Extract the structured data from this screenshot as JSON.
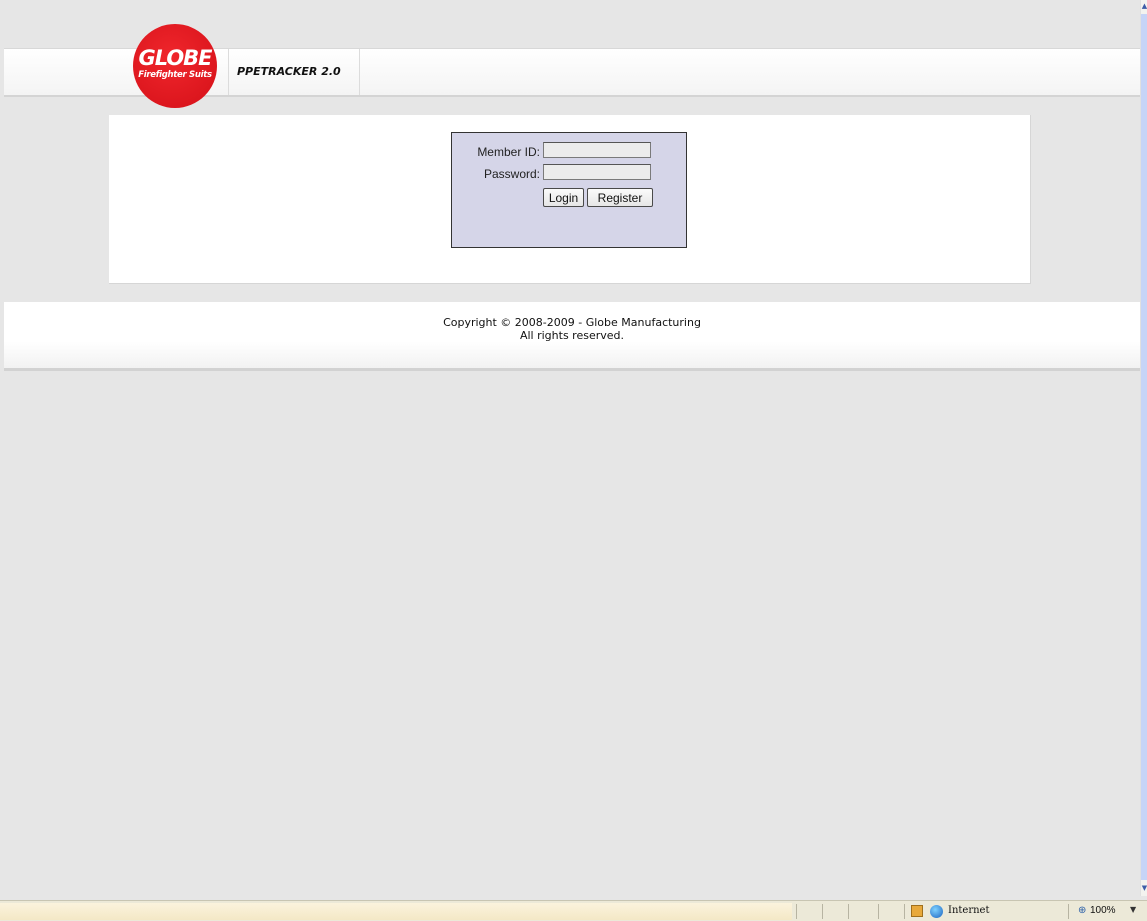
{
  "header": {
    "logo_text": "GLOBE",
    "logo_subtext": "Firefighter Suits",
    "app_title": "PPETRACKER 2.0"
  },
  "login": {
    "member_id_label": "Member ID:",
    "member_id_value": "",
    "password_label": "Password:",
    "password_value": "",
    "login_button": "Login",
    "register_button": "Register",
    "box_color": "#d5d5e8"
  },
  "footer": {
    "copyright": "Copyright © 2008-2009 - Globe Manufacturing",
    "rights": "All rights reserved."
  },
  "statusbar": {
    "zone_label": "Internet",
    "zoom_label": "100%",
    "icons": [
      "security-zone-icon",
      "internet-globe-icon",
      "zoom-icon",
      "dropdown-arrow-icon"
    ]
  },
  "colors": {
    "logo_red": "#e11a22",
    "page_background": "#e6e6e6"
  }
}
